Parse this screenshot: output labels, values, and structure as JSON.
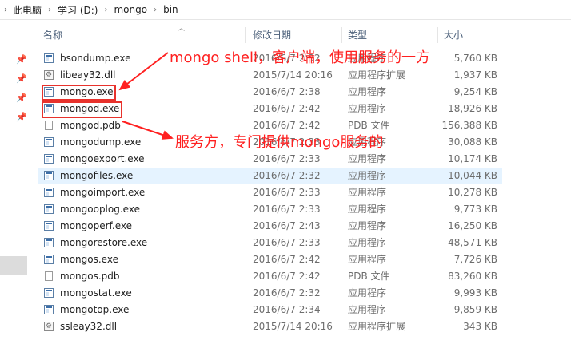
{
  "breadcrumb": [
    "此电脑",
    "学习 (D:)",
    "mongo",
    "bin"
  ],
  "columns": {
    "name": "名称",
    "date": "修改日期",
    "type": "类型",
    "size": "大小"
  },
  "files": [
    {
      "name": "bsondump.exe",
      "date": "2016/6/7 2:32",
      "type": "应用程序",
      "size": "5,760 KB",
      "icon": "exe-icon"
    },
    {
      "name": "libeay32.dll",
      "date": "2015/7/14 20:16",
      "type": "应用程序扩展",
      "size": "1,937 KB",
      "icon": "dll-icon"
    },
    {
      "name": "mongo.exe",
      "date": "2016/6/7 2:38",
      "type": "应用程序",
      "size": "9,254 KB",
      "icon": "exe-icon"
    },
    {
      "name": "mongod.exe",
      "date": "2016/6/7 2:42",
      "type": "应用程序",
      "size": "18,926 KB",
      "icon": "exe-icon"
    },
    {
      "name": "mongod.pdb",
      "date": "2016/6/7 2:42",
      "type": "PDB 文件",
      "size": "156,388 KB",
      "icon": "file-icon"
    },
    {
      "name": "mongodump.exe",
      "date": "2016/6/7 2:33",
      "type": "应用程序",
      "size": "30,088 KB",
      "icon": "exe-icon"
    },
    {
      "name": "mongoexport.exe",
      "date": "2016/6/7 2:33",
      "type": "应用程序",
      "size": "10,174 KB",
      "icon": "exe-icon"
    },
    {
      "name": "mongofiles.exe",
      "date": "2016/6/7 2:32",
      "type": "应用程序",
      "size": "10,044 KB",
      "icon": "exe-icon"
    },
    {
      "name": "mongoimport.exe",
      "date": "2016/6/7 2:33",
      "type": "应用程序",
      "size": "10,278 KB",
      "icon": "exe-icon"
    },
    {
      "name": "mongooplog.exe",
      "date": "2016/6/7 2:33",
      "type": "应用程序",
      "size": "9,773 KB",
      "icon": "exe-icon"
    },
    {
      "name": "mongoperf.exe",
      "date": "2016/6/7 2:43",
      "type": "应用程序",
      "size": "16,250 KB",
      "icon": "exe-icon"
    },
    {
      "name": "mongorestore.exe",
      "date": "2016/6/7 2:33",
      "type": "应用程序",
      "size": "48,571 KB",
      "icon": "exe-icon"
    },
    {
      "name": "mongos.exe",
      "date": "2016/6/7 2:42",
      "type": "应用程序",
      "size": "7,726 KB",
      "icon": "exe-icon"
    },
    {
      "name": "mongos.pdb",
      "date": "2016/6/7 2:42",
      "type": "PDB 文件",
      "size": "83,260 KB",
      "icon": "file-icon"
    },
    {
      "name": "mongostat.exe",
      "date": "2016/6/7 2:32",
      "type": "应用程序",
      "size": "9,993 KB",
      "icon": "exe-icon"
    },
    {
      "name": "mongotop.exe",
      "date": "2016/6/7 2:34",
      "type": "应用程序",
      "size": "9,859 KB",
      "icon": "exe-icon"
    },
    {
      "name": "ssleay32.dll",
      "date": "2015/7/14 20:16",
      "type": "应用程序扩展",
      "size": "343 KB",
      "icon": "dll-icon"
    }
  ],
  "selected_file": "mongofiles.exe",
  "annotations": {
    "mongo_shell": "mongo shell，客户端，使用服务的一方",
    "mongod_server": "服务方，专门提供mongo服务的"
  },
  "colors": {
    "annotation": "#ff2020",
    "highlight_box": "#e8322c",
    "selection": "#e5f3ff",
    "header_text": "#4c607a"
  },
  "icons": [
    "pin-icon",
    "exe-icon",
    "dll-icon",
    "file-icon",
    "chevron-right-icon",
    "sort-up-icon"
  ]
}
